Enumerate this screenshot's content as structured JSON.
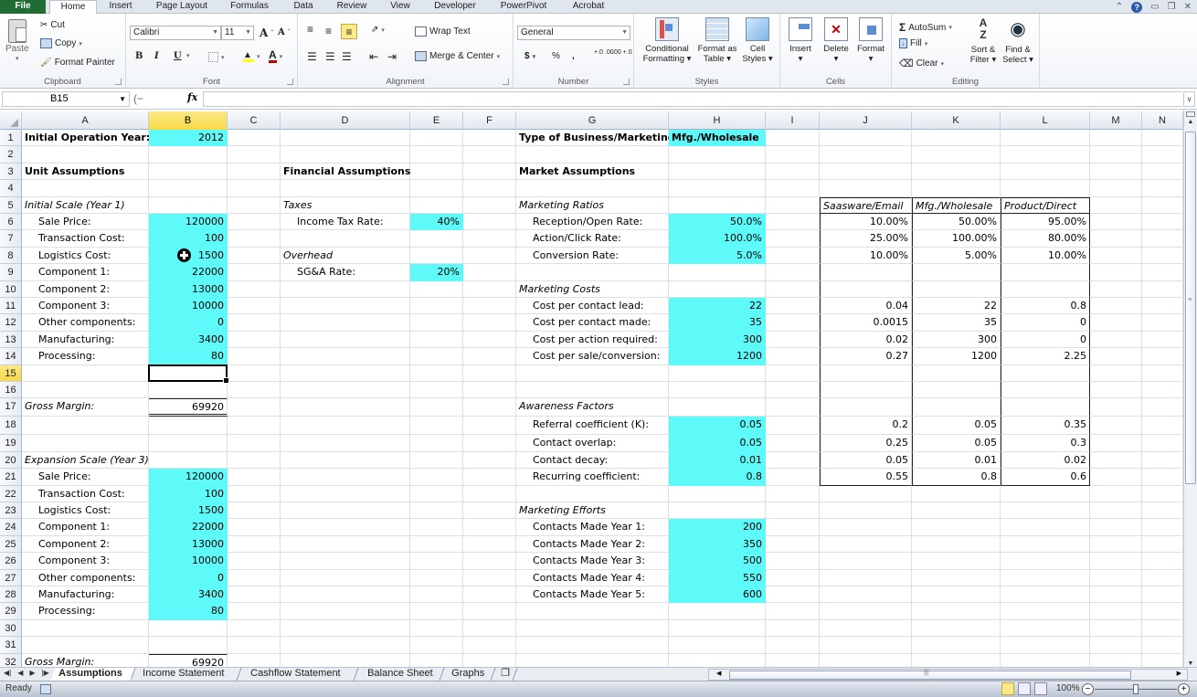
{
  "ribbon_tabs": [
    "File",
    "Home",
    "Insert",
    "Page Layout",
    "Formulas",
    "Data",
    "Review",
    "View",
    "Developer",
    "PowerPivot",
    "Acrobat"
  ],
  "active_tab": "Home",
  "ribbon": {
    "clipboard": {
      "paste": "Paste",
      "cut": "Cut",
      "copy": "Copy",
      "format_painter": "Format Painter",
      "label": "Clipboard"
    },
    "font": {
      "font_name": "Calibri",
      "font_size": "11",
      "bold": "B",
      "italic": "I",
      "underline": "U",
      "label": "Font"
    },
    "alignment": {
      "wrap_text": "Wrap Text",
      "merge_center": "Merge & Center",
      "label": "Alignment"
    },
    "number": {
      "format": "General",
      "currency": "$",
      "percent": "%",
      "comma": ",",
      "inc_decimal": "+.0 .00",
      "dec_decimal": ".00 +.0",
      "label": "Number"
    },
    "styles": {
      "conditional": "Conditional Formatting",
      "format_table": "Format as Table",
      "cell_styles": "Cell Styles",
      "label": "Styles"
    },
    "cells": {
      "insert": "Insert",
      "delete": "Delete",
      "format": "Format",
      "label": "Cells"
    },
    "editing": {
      "autosum": "AutoSum",
      "fill": "Fill",
      "clear": "Clear",
      "sort_filter": "Sort & Filter",
      "find_select": "Find & Select",
      "label": "Editing"
    }
  },
  "formula_bar": {
    "name_box": "B15",
    "fx": "fx",
    "formula": ""
  },
  "columns": [
    "A",
    "B",
    "C",
    "D",
    "E",
    "F",
    "G",
    "H",
    "I",
    "J",
    "K",
    "L",
    "M",
    "N"
  ],
  "selected_cell": "B15",
  "sheet": {
    "initial_year_label": "Initial Operation Year:",
    "initial_year": "2012",
    "business_type_label": "Type of Business/Marketing:",
    "business_type": "Mfg./Wholesale",
    "unit_assumptions": "Unit Assumptions",
    "financial_assumptions": "Financial Assumptions",
    "market_assumptions": "Market Assumptions",
    "initial_scale": {
      "title": "Initial Scale (Year 1)",
      "items": [
        {
          "label": "Sale Price:",
          "value": "120000"
        },
        {
          "label": "Transaction Cost:",
          "value": "100"
        },
        {
          "label": "Logistics Cost:",
          "value": "1500"
        },
        {
          "label": "Component 1:",
          "value": "22000"
        },
        {
          "label": "Component 2:",
          "value": "13000"
        },
        {
          "label": "Component 3:",
          "value": "10000"
        },
        {
          "label": "Other components:",
          "value": "0"
        },
        {
          "label": "Manufacturing:",
          "value": "3400"
        },
        {
          "label": "Processing:",
          "value": "80"
        }
      ],
      "gross_margin_label": "Gross Margin:",
      "gross_margin": "69920"
    },
    "expansion_scale": {
      "title": "Expansion Scale (Year 3)",
      "items": [
        {
          "label": "Sale Price:",
          "value": "120000"
        },
        {
          "label": "Transaction Cost:",
          "value": "100"
        },
        {
          "label": "Logistics Cost:",
          "value": "1500"
        },
        {
          "label": "Component 1:",
          "value": "22000"
        },
        {
          "label": "Component 2:",
          "value": "13000"
        },
        {
          "label": "Component 3:",
          "value": "10000"
        },
        {
          "label": "Other components:",
          "value": "0"
        },
        {
          "label": "Manufacturing:",
          "value": "3400"
        },
        {
          "label": "Processing:",
          "value": "80"
        }
      ],
      "gross_margin_label": "Gross Margin:",
      "gross_margin": "69920"
    },
    "taxes": {
      "title": "Taxes",
      "label": "Income Tax Rate:",
      "value": "40%"
    },
    "overhead": {
      "title": "Overhead",
      "label": "SG&A Rate:",
      "value": "20%"
    },
    "marketing_ratios": {
      "title": "Marketing Ratios",
      "items": [
        {
          "label": "Reception/Open Rate:",
          "value": "50.0%"
        },
        {
          "label": "Action/Click Rate:",
          "value": "100.0%"
        },
        {
          "label": "Conversion Rate:",
          "value": "5.0%"
        }
      ]
    },
    "marketing_costs": {
      "title": "Marketing Costs",
      "items": [
        {
          "label": "Cost per contact lead:",
          "value": "22"
        },
        {
          "label": "Cost per contact made:",
          "value": "35"
        },
        {
          "label": "Cost per action required:",
          "value": "300"
        },
        {
          "label": "Cost per sale/conversion:",
          "value": "1200"
        }
      ]
    },
    "awareness_factors": {
      "title": "Awareness Factors",
      "items": [
        {
          "label": "Referral coefficient (K):",
          "value": "0.05"
        },
        {
          "label": "Contact overlap:",
          "value": "0.05"
        },
        {
          "label": "Contact decay:",
          "value": "0.01"
        },
        {
          "label": "Recurring coefficient:",
          "value": "0.8"
        }
      ]
    },
    "marketing_efforts": {
      "title": "Marketing Efforts",
      "items": [
        {
          "label": "Contacts Made Year 1:",
          "value": "200"
        },
        {
          "label": "Contacts Made Year 2:",
          "value": "350"
        },
        {
          "label": "Contacts Made Year 3:",
          "value": "500"
        },
        {
          "label": "Contacts Made Year 4:",
          "value": "550"
        },
        {
          "label": "Contacts Made Year 5:",
          "value": "600"
        }
      ]
    },
    "lookup_table": {
      "headers": [
        "Saasware/Email",
        "Mfg./Wholesale",
        "Product/Direct"
      ],
      "ratios": [
        [
          "10.00%",
          "50.00%",
          "95.00%"
        ],
        [
          "25.00%",
          "100.00%",
          "80.00%"
        ],
        [
          "10.00%",
          "5.00%",
          "10.00%"
        ]
      ],
      "costs": [
        [
          "0.04",
          "22",
          "0.8"
        ],
        [
          "0.0015",
          "35",
          "0"
        ],
        [
          "0.02",
          "300",
          "0"
        ],
        [
          "0.27",
          "1200",
          "2.25"
        ]
      ],
      "awareness": [
        [
          "0.2",
          "0.05",
          "0.35"
        ],
        [
          "0.25",
          "0.05",
          "0.3"
        ],
        [
          "0.05",
          "0.01",
          "0.02"
        ],
        [
          "0.55",
          "0.8",
          "0.6"
        ]
      ]
    }
  },
  "sheet_tabs": [
    "Assumptions",
    "Income Statement",
    "Cashflow Statement",
    "Balance Sheet",
    "Graphs"
  ],
  "active_sheet": "Assumptions",
  "status": {
    "ready": "Ready",
    "zoom": "100%"
  },
  "colors": {
    "input_fill": "#5ef9f9",
    "selection_header": "#f7d843",
    "file_tab": "#1f6d33"
  }
}
